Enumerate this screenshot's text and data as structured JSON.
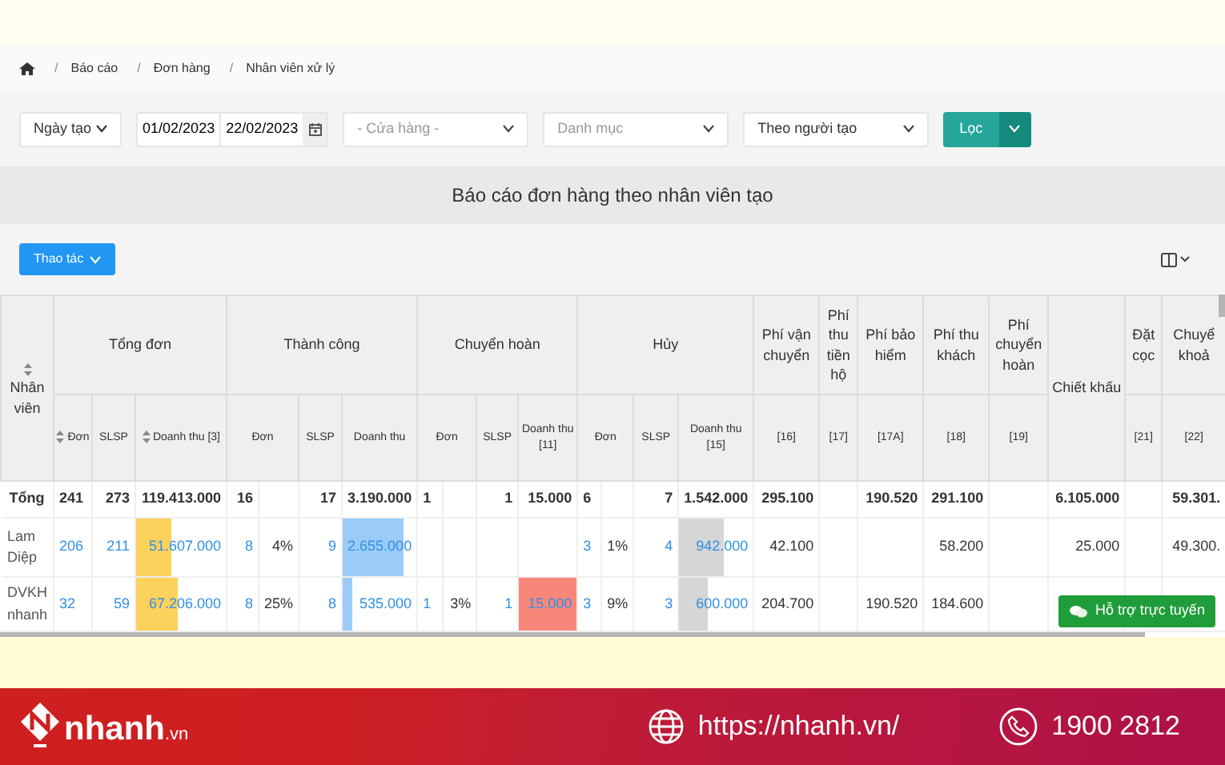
{
  "breadcrumb": [
    {
      "separator": "/",
      "label": "Báo cáo"
    },
    {
      "separator": "/",
      "label": "Đơn hàng"
    },
    {
      "separator": "/",
      "label": "Nhân viên xử lý"
    }
  ],
  "filters": {
    "date_type": "Ngày tạo",
    "date_from": "01/02/2023",
    "date_to": "22/02/2023",
    "store": {
      "placeholder": "- Cửa hàng -"
    },
    "category": {
      "placeholder": "Danh mục"
    },
    "group_by": "Theo người tạo",
    "filter_button": "Lọc"
  },
  "report_title": "Báo cáo đơn hàng theo nhân viên tạo",
  "action_button": "Thao tác",
  "table": {
    "header_groups": [
      {
        "label": "Nhân viên",
        "sortable": true
      },
      {
        "label": "Tổng đơn",
        "subheaders": [
          {
            "label": "Đơn",
            "sortable": true,
            "kind": "count"
          },
          {
            "label": "SLSP",
            "kind": "count"
          },
          {
            "label": "Doanh thu [3]",
            "sortable": true,
            "kind": "count"
          }
        ]
      },
      {
        "label": "Thành công",
        "subheaders": [
          {
            "label": "Đơn",
            "kind": "count_percent"
          },
          {
            "label": "SLSP",
            "kind": "count"
          },
          {
            "label": "Doanh thu",
            "kind": "count"
          }
        ]
      },
      {
        "label": "Chuyển hoàn",
        "subheaders": [
          {
            "label": "Đơn",
            "kind": "count_percent"
          },
          {
            "label": "SLSP",
            "kind": "count"
          },
          {
            "label": "Doanh thu [11]",
            "kind": "count"
          }
        ]
      },
      {
        "label": "Hủy",
        "subheaders": [
          {
            "label": "Đơn",
            "kind": "count_percent"
          },
          {
            "label": "SLSP",
            "kind": "count"
          },
          {
            "label": "Doanh thu [15]",
            "kind": "count"
          }
        ]
      },
      {
        "label": "Phí vận chuyển",
        "subheaders": [
          {
            "label": "[16]",
            "kind": "count"
          }
        ]
      },
      {
        "label": "Phí thu tiền hộ",
        "subheaders": [
          {
            "label": "[17]",
            "kind": "count"
          }
        ]
      },
      {
        "label": "Phí bảo hiểm",
        "subheaders": [
          {
            "label": "[17A]",
            "kind": "count"
          }
        ]
      },
      {
        "label": "Phí thu khách",
        "subheaders": [
          {
            "label": "[18]",
            "kind": "count"
          }
        ]
      },
      {
        "label": "Phí chuyển hoàn",
        "subheaders": [
          {
            "label": "[19]",
            "kind": "count"
          }
        ]
      },
      {
        "label": "Chiết khấu"
      },
      {
        "label": "Đặt cọc",
        "subheaders": [
          {
            "label": "[21]",
            "kind": "count"
          }
        ]
      },
      {
        "label": "Chuyể khoả",
        "subheaders": [
          {
            "label": "[22]",
            "kind": "count"
          }
        ]
      }
    ],
    "rows": [
      {
        "kind": "total",
        "name": "Tổng",
        "cells": [
          {
            "text": "241"
          },
          {
            "text": "273"
          },
          {
            "text": "119.413.000"
          },
          {
            "text": "16"
          },
          {},
          {
            "text": "17"
          },
          {
            "text": "3.190.000"
          },
          {
            "text": "1"
          },
          {},
          {
            "text": "1"
          },
          {
            "text": "15.000"
          },
          {
            "text": "6"
          },
          {},
          {
            "text": "7"
          },
          {
            "text": "1.542.000"
          },
          {
            "text": "295.100"
          },
          {},
          {
            "text": "190.520"
          },
          {
            "text": "291.100"
          },
          {},
          {
            "text": "6.105.000"
          },
          {},
          {
            "text": "59.301."
          }
        ]
      },
      {
        "kind": "staff",
        "name": "Lam Diệp",
        "cells": [
          {
            "text": "206"
          },
          {
            "text": "211"
          },
          {
            "text": "51.607.000",
            "level": 0.4,
            "color": "#fcd15c"
          },
          {
            "text": "8"
          },
          {
            "text": "4%"
          },
          {
            "text": "9"
          },
          {
            "text": "2.655.000",
            "level": 0.83,
            "color": "#9ccbf8"
          },
          {},
          {},
          {},
          {},
          {
            "text": "3"
          },
          {
            "text": "1%"
          },
          {
            "text": "4"
          },
          {
            "text": "942.000",
            "level": 0.6,
            "color": "#d6d6d6"
          },
          {
            "text": "42.100"
          },
          {},
          {},
          {
            "text": "58.200"
          },
          {},
          {
            "text": "25.000"
          },
          {},
          {
            "text": "49.300."
          }
        ]
      },
      {
        "kind": "staff",
        "name": "DVKH nhanh",
        "cells": [
          {
            "text": "32"
          },
          {
            "text": "59"
          },
          {
            "text": "67.206.000",
            "level": 0.46,
            "color": "#fcd15c"
          },
          {
            "text": "8"
          },
          {
            "text": "25%"
          },
          {
            "text": "8"
          },
          {
            "text": "535.000",
            "level": 0.13,
            "color": "#9ccbf8"
          },
          {
            "text": "1"
          },
          {
            "text": "3%"
          },
          {
            "text": "1"
          },
          {
            "text": "15.000",
            "level": 1,
            "color": "#f8877a"
          },
          {
            "text": "3"
          },
          {
            "text": "9%"
          },
          {
            "text": "3"
          },
          {
            "text": "600.000",
            "level": 0.39,
            "color": "#d6d6d6"
          },
          {
            "text": "204.700"
          },
          {},
          {
            "text": "190.520"
          },
          {
            "text": "184.600"
          },
          {},
          {},
          {},
          {}
        ]
      }
    ]
  },
  "chat_button": "Hỗ trợ trực tuyến",
  "footer": {
    "brand": "nhanh",
    "brand_suffix": ".vn",
    "website": "https://nhanh.vn/",
    "phone": "1900 2812"
  }
}
